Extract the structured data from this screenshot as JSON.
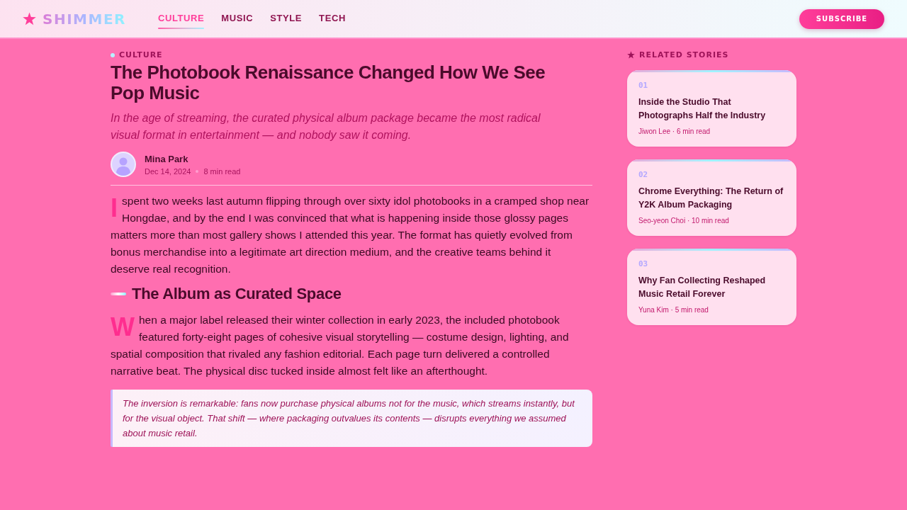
{
  "header": {
    "logo": "SHIMMER",
    "nav": [
      {
        "label": "CULTURE",
        "selected": true
      },
      {
        "label": "MUSIC",
        "selected": false
      },
      {
        "label": "STYLE",
        "selected": false
      },
      {
        "label": "TECH",
        "selected": false
      }
    ],
    "subscribe_button": "SUBSCRIBE"
  },
  "article": {
    "kicker": "CULTURE",
    "title": "The Photobook Renaissance Changed How We See Pop Music",
    "dek": "In the age of streaming, the curated physical album package became the most radical visual format in entertainment — and nobody saw it coming.",
    "author": {
      "name": "Mina Park",
      "date": "Dec 14, 2024",
      "read_time": "8 min read"
    },
    "body": [
      {
        "kind": "paragraph",
        "text": "I spent two weeks last autumn flipping through over sixty idol photobooks in a cramped shop near Hongdae, and by the end I was convinced that what is happening inside those glossy pages matters more than most gallery shows I attended this year. The format has quietly evolved from bonus merchandise into a legitimate art direction medium, and the creative teams behind it deserve real recognition."
      },
      {
        "kind": "heading",
        "text": "The Album as Curated Space"
      },
      {
        "kind": "paragraph",
        "text": "When a major label released their winter collection in early 2023, the included photobook featured forty-eight pages of cohesive visual storytelling — costume design, lighting, and spatial composition that rivaled any fashion editorial. Each page turn delivered a controlled narrative beat. The physical disc tucked inside almost felt like an afterthought."
      },
      {
        "kind": "quote",
        "text": "The inversion is remarkable: fans now purchase physical albums not for the music, which streams instantly, but for the visual object. That shift — where packaging outvalues its contents — disrupts everything we assumed about music retail."
      }
    ]
  },
  "sidebar": {
    "heading": "RELATED STORIES",
    "stories": [
      {
        "number": "01",
        "title": "Inside the Studio That Photographs Half the Industry",
        "meta": "Jiwon Lee · 6 min read"
      },
      {
        "number": "02",
        "title": "Chrome Everything: The Return of Y2K Album Packaging",
        "meta": "Seo-yeon Choi · 10 min read"
      },
      {
        "number": "03",
        "title": "Why Fan Collecting Reshaped Music Retail Forever",
        "meta": "Yuna Kim · 5 min read"
      }
    ]
  }
}
